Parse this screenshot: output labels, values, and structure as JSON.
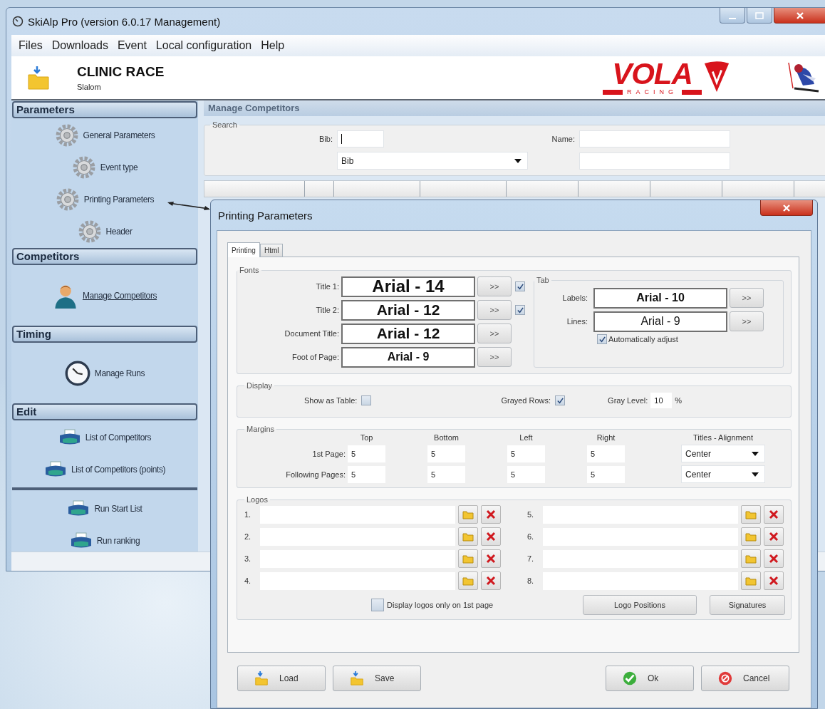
{
  "window": {
    "title": "SkiAlp Pro (version 6.0.17 Management)"
  },
  "menu": [
    "Files",
    "Downloads",
    "Event",
    "Local configuration",
    "Help"
  ],
  "banner": {
    "title": "CLINIC RACE",
    "subtitle": "Slalom",
    "logo_word": "VOLA",
    "logo_tagline": "RACING"
  },
  "sidebar": {
    "sections": [
      {
        "title": "Parameters",
        "items": [
          {
            "label": "General Parameters",
            "kind": "gear",
            "link": false
          },
          {
            "label": "Event type",
            "kind": "gear",
            "link": false
          },
          {
            "label": "Printing Parameters",
            "kind": "gear",
            "link": false
          },
          {
            "label": "Header",
            "kind": "gear",
            "link": false
          }
        ]
      },
      {
        "title": "Competitors",
        "items": [
          {
            "label": "Manage Competitors",
            "kind": "person",
            "link": true
          }
        ]
      },
      {
        "title": "Timing",
        "items": [
          {
            "label": "Manage Runs",
            "kind": "clock",
            "link": false
          }
        ]
      },
      {
        "title": "Edit",
        "items": [
          {
            "label": "List of Competitors",
            "kind": "printer",
            "link": false
          },
          {
            "label": "List of Competitors (points)",
            "kind": "printer",
            "link": false
          }
        ]
      },
      {
        "items": [
          {
            "label": "Run Start List",
            "kind": "printer",
            "link": false
          },
          {
            "label": "Run ranking",
            "kind": "printer",
            "link": false
          }
        ]
      }
    ]
  },
  "content": {
    "title": "Manage Competitors",
    "search": {
      "legend": "Search",
      "bib_label": "Bib:",
      "name_label": "Name:",
      "sort_by": "Bib"
    }
  },
  "dialog": {
    "title": "Printing Parameters",
    "tabs": [
      {
        "label": "Printing",
        "selected": true
      },
      {
        "label": "Html",
        "selected": false
      }
    ],
    "fonts": {
      "legend": "Fonts",
      "rows": [
        {
          "label": "Title 1:",
          "value": "Arial - 14",
          "kind": "large",
          "button": ">>",
          "checkbox": {
            "checked": true
          }
        },
        {
          "label": "Title 2:",
          "value": "Arial - 12",
          "kind": "medium",
          "button": ">>",
          "checkbox": {
            "checked": true
          }
        },
        {
          "label": "Document Title:",
          "value": "Arial - 12",
          "kind": "medium",
          "button": ">>"
        },
        {
          "label": "Foot of Page:",
          "value": "Arial - 9",
          "kind": "small",
          "button": ">>"
        }
      ]
    },
    "tab_fonts": {
      "legend": "Tab",
      "rows": [
        {
          "label": "Labels:",
          "value": "Arial - 10",
          "kind": "small",
          "button": ">>"
        },
        {
          "label": "Lines:",
          "value": "Arial - 9",
          "kind": "regular",
          "button": ">>"
        }
      ],
      "auto_adjust": {
        "label": "Automatically adjust",
        "checked": true
      }
    },
    "display": {
      "legend": "Display",
      "show_as_table": {
        "label": "Show as Table:",
        "checked": false
      },
      "grayed_rows": {
        "label": "Grayed Rows:",
        "checked": true
      },
      "gray_level": {
        "label": "Gray Level:",
        "value": "10",
        "unit": "%"
      }
    },
    "margins": {
      "legend": "Margins",
      "columns": [
        "Top",
        "Bottom",
        "Left",
        "Right",
        "Titles - Alignment"
      ],
      "rows": [
        {
          "label": "1st Page:",
          "values": [
            "5",
            "5",
            "5",
            "5"
          ],
          "alignment": "Center"
        },
        {
          "label": "Following Pages:",
          "values": [
            "5",
            "5",
            "5",
            "5"
          ],
          "alignment": "Center"
        }
      ]
    },
    "logos": {
      "legend": "Logos",
      "slots": [
        {
          "number": "1."
        },
        {
          "number": "2."
        },
        {
          "number": "3."
        },
        {
          "number": "4."
        },
        {
          "number": "5."
        },
        {
          "number": "6."
        },
        {
          "number": "7."
        },
        {
          "number": "8."
        }
      ],
      "only_first_page": {
        "label": "Display logos only on 1st page",
        "checked": false
      },
      "buttons": [
        "Logo Positions",
        "Signatures"
      ]
    },
    "buttons": [
      {
        "label": "Load",
        "kind": "load"
      },
      {
        "label": "Save",
        "kind": "save"
      },
      {
        "label": "Ok",
        "kind": "ok"
      },
      {
        "label": "Cancel",
        "kind": "cancel"
      }
    ]
  }
}
